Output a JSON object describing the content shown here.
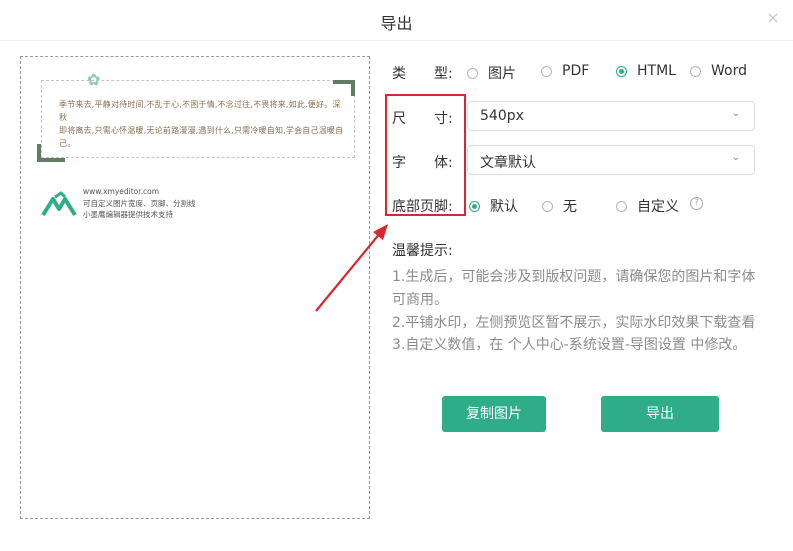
{
  "dialog": {
    "title": "导出",
    "close_symbol": "×"
  },
  "preview": {
    "card_lines": [
      "季节来去,平静对待时间,不乱于心,不困于情,不念过往,不畏将来,如此,便好。深秋",
      "即将离去,只需心怀温暖,无论前路漫漫,遇到什么,只需冷暖自知,学会自己温暖自",
      "己。"
    ],
    "brand_lines": [
      "www.xmyeditor.com",
      "可自定义图片宽度、页脚、分割线",
      "小墨鹰编辑器提供技术支持"
    ]
  },
  "form": {
    "type": {
      "label": "类　　型:",
      "options": [
        {
          "label": "图片",
          "checked": false
        },
        {
          "label": "PDF",
          "checked": false
        },
        {
          "label": "HTML",
          "checked": true
        },
        {
          "label": "Word",
          "checked": false
        }
      ]
    },
    "size": {
      "label": "尺　　寸:",
      "value": "540px"
    },
    "font": {
      "label": "字　　体:",
      "value": "文章默认"
    },
    "footer": {
      "label": "底部页脚:",
      "options": [
        {
          "label": "默认",
          "checked": true
        },
        {
          "label": "无",
          "checked": false
        },
        {
          "label": "自定义",
          "checked": false
        }
      ],
      "help_symbol": "?"
    }
  },
  "tips": {
    "title": "温馨提示:",
    "lines": [
      "1.生成后，可能会涉及到版权问题，请确保您的图片和字体",
      "可商用。",
      "2.平铺水印，左侧预览区暂不展示，实际水印效果下载查看",
      "3.自定义数值，在 个人中心-系统设置-导图设置 中修改。"
    ]
  },
  "buttons": {
    "copy": "复制图片",
    "export": "导出"
  },
  "colors": {
    "accent": "#2ead88",
    "annotation": "#d9262f",
    "frame": "#5e7d64"
  }
}
